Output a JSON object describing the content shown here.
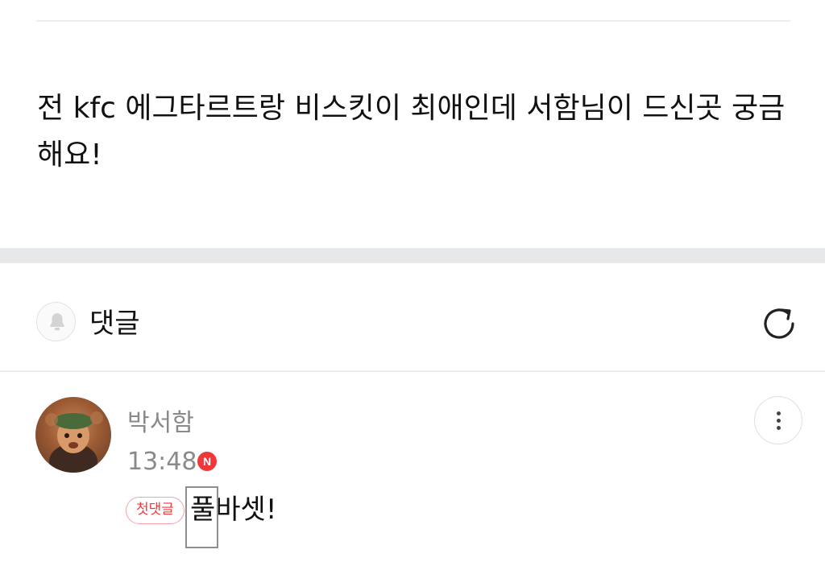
{
  "post": {
    "body": "전 kfc 에그타르트랑 비스킷이 최애인데 서함님이 드신곳 궁금해요!"
  },
  "comments_section": {
    "title": "댓글",
    "bell_icon": "bell-icon",
    "refresh_icon": "refresh-icon"
  },
  "comment": {
    "author": "박서함",
    "time": "13:48",
    "new_badge": "N",
    "first_comment_badge": "첫댓글",
    "text": "풀바셋!",
    "more_icon": "more-vertical-icon"
  },
  "colors": {
    "accent_red": "#f0383b",
    "badge_border": "#f3a3a6",
    "muted_text": "#8a8a8a",
    "section_gap": "#e7e8ea"
  }
}
